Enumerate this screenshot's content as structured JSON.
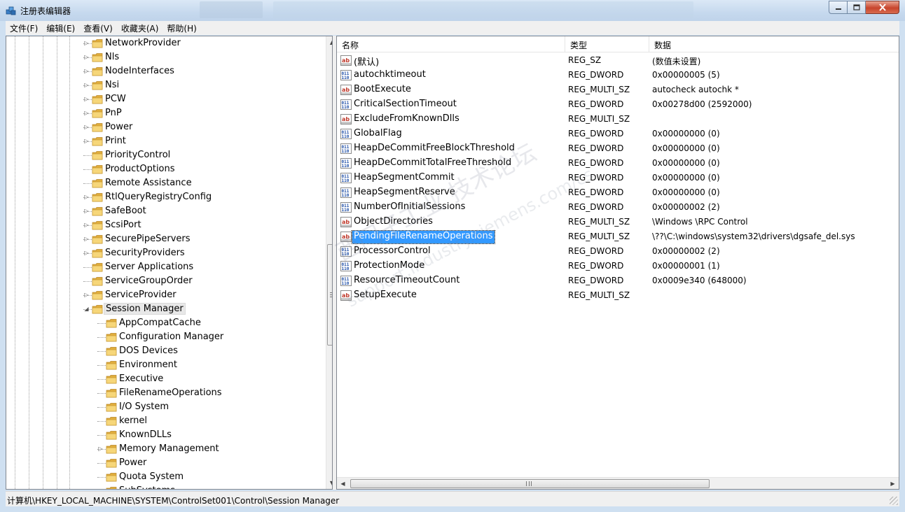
{
  "window": {
    "title": "注册表编辑器",
    "min_icon": "minimize-icon",
    "max_icon": "maximize-icon",
    "close_icon": "close-icon"
  },
  "menu": [
    "文件(F)",
    "编辑(E)",
    "查看(V)",
    "收藏夹(A)",
    "帮助(H)"
  ],
  "tree": {
    "items": [
      {
        "label": "NetworkProvider",
        "level": 1,
        "expander": true
      },
      {
        "label": "Nls",
        "level": 1,
        "expander": true
      },
      {
        "label": "NodeInterfaces",
        "level": 1,
        "expander": true
      },
      {
        "label": "Nsi",
        "level": 1,
        "expander": true
      },
      {
        "label": "PCW",
        "level": 1,
        "expander": true
      },
      {
        "label": "PnP",
        "level": 1,
        "expander": true
      },
      {
        "label": "Power",
        "level": 1,
        "expander": true
      },
      {
        "label": "Print",
        "level": 1,
        "expander": true
      },
      {
        "label": "PriorityControl",
        "level": 1,
        "expander": false
      },
      {
        "label": "ProductOptions",
        "level": 1,
        "expander": false
      },
      {
        "label": "Remote Assistance",
        "level": 1,
        "expander": false
      },
      {
        "label": "RtlQueryRegistryConfig",
        "level": 1,
        "expander": true
      },
      {
        "label": "SafeBoot",
        "level": 1,
        "expander": true
      },
      {
        "label": "ScsiPort",
        "level": 1,
        "expander": true
      },
      {
        "label": "SecurePipeServers",
        "level": 1,
        "expander": true
      },
      {
        "label": "SecurityProviders",
        "level": 1,
        "expander": true
      },
      {
        "label": "Server Applications",
        "level": 1,
        "expander": false
      },
      {
        "label": "ServiceGroupOrder",
        "level": 1,
        "expander": false
      },
      {
        "label": "ServiceProvider",
        "level": 1,
        "expander": true
      },
      {
        "label": "Session Manager",
        "level": 1,
        "expander": "open",
        "selected": true
      },
      {
        "label": "AppCompatCache",
        "level": 2,
        "expander": false
      },
      {
        "label": "Configuration Manager",
        "level": 2,
        "expander": false
      },
      {
        "label": "DOS Devices",
        "level": 2,
        "expander": false
      },
      {
        "label": "Environment",
        "level": 2,
        "expander": false
      },
      {
        "label": "Executive",
        "level": 2,
        "expander": false
      },
      {
        "label": "FileRenameOperations",
        "level": 2,
        "expander": false
      },
      {
        "label": "I/O System",
        "level": 2,
        "expander": false
      },
      {
        "label": "kernel",
        "level": 2,
        "expander": false
      },
      {
        "label": "KnownDLLs",
        "level": 2,
        "expander": false
      },
      {
        "label": "Memory Management",
        "level": 2,
        "expander": true
      },
      {
        "label": "Power",
        "level": 2,
        "expander": false
      },
      {
        "label": "Quota System",
        "level": 2,
        "expander": false
      },
      {
        "label": "SubSystems",
        "level": 2,
        "expander": false
      }
    ]
  },
  "list": {
    "columns": {
      "name": "名称",
      "type": "类型",
      "data": "数据"
    },
    "rows": [
      {
        "icon": "string-value-icon",
        "name": "(默认)",
        "type": "REG_SZ",
        "data": "(数值未设置)"
      },
      {
        "icon": "binary-value-icon",
        "name": "autochktimeout",
        "type": "REG_DWORD",
        "data": "0x00000005 (5)"
      },
      {
        "icon": "string-value-icon",
        "name": "BootExecute",
        "type": "REG_MULTI_SZ",
        "data": "autocheck autochk *"
      },
      {
        "icon": "binary-value-icon",
        "name": "CriticalSectionTimeout",
        "type": "REG_DWORD",
        "data": "0x00278d00 (2592000)"
      },
      {
        "icon": "string-value-icon",
        "name": "ExcludeFromKnownDlls",
        "type": "REG_MULTI_SZ",
        "data": ""
      },
      {
        "icon": "binary-value-icon",
        "name": "GlobalFlag",
        "type": "REG_DWORD",
        "data": "0x00000000 (0)"
      },
      {
        "icon": "binary-value-icon",
        "name": "HeapDeCommitFreeBlockThreshold",
        "type": "REG_DWORD",
        "data": "0x00000000 (0)"
      },
      {
        "icon": "binary-value-icon",
        "name": "HeapDeCommitTotalFreeThreshold",
        "type": "REG_DWORD",
        "data": "0x00000000 (0)"
      },
      {
        "icon": "binary-value-icon",
        "name": "HeapSegmentCommit",
        "type": "REG_DWORD",
        "data": "0x00000000 (0)"
      },
      {
        "icon": "binary-value-icon",
        "name": "HeapSegmentReserve",
        "type": "REG_DWORD",
        "data": "0x00000000 (0)"
      },
      {
        "icon": "binary-value-icon",
        "name": "NumberOfInitialSessions",
        "type": "REG_DWORD",
        "data": "0x00000002 (2)"
      },
      {
        "icon": "string-value-icon",
        "name": "ObjectDirectories",
        "type": "REG_MULTI_SZ",
        "data": "\\Windows \\RPC Control"
      },
      {
        "icon": "string-value-icon",
        "name": "PendingFileRenameOperations",
        "type": "REG_MULTI_SZ",
        "data": "\\??\\C:\\windows\\system32\\drivers\\dgsafe_del.sys",
        "selected": true
      },
      {
        "icon": "binary-value-icon",
        "name": "ProcessorControl",
        "type": "REG_DWORD",
        "data": "0x00000002 (2)"
      },
      {
        "icon": "binary-value-icon",
        "name": "ProtectionMode",
        "type": "REG_DWORD",
        "data": "0x00000001 (1)"
      },
      {
        "icon": "binary-value-icon",
        "name": "ResourceTimeoutCount",
        "type": "REG_DWORD",
        "data": "0x0009e340 (648000)"
      },
      {
        "icon": "string-value-icon",
        "name": "SetupExecute",
        "type": "REG_MULTI_SZ",
        "data": ""
      }
    ]
  },
  "statusbar": {
    "path": "计算机\\HKEY_LOCAL_MACHINE\\SYSTEM\\ControlSet001\\Control\\Session Manager"
  },
  "watermark": {
    "line1": "西门子工业 技术论坛",
    "line2": "support.industry.siemens.com/cs"
  },
  "colors": {
    "selection": "#3399ff",
    "folder": "#e8c15a",
    "close_button": "#c8452d"
  }
}
